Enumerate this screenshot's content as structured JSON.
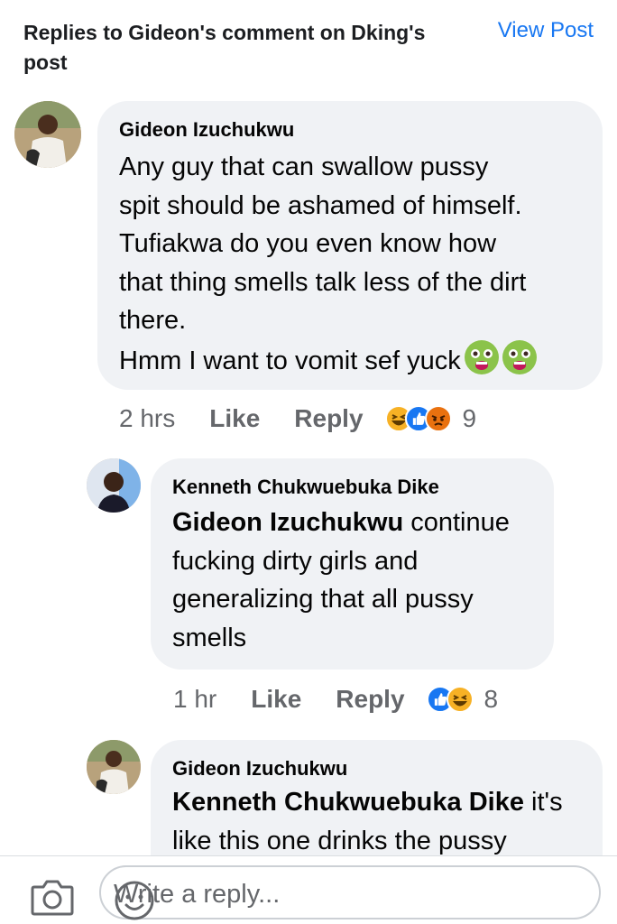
{
  "header": {
    "title": "Replies to Gideon's comment on Dking's post",
    "view_post": "View Post"
  },
  "comments": [
    {
      "author": "Gideon Izuchukwu",
      "lines": [
        "Any guy that can swallow pussy",
        "spit should be ashamed of himself.",
        "Tufiakwa do you even know how",
        "that thing smells talk less of the dirt",
        "there.",
        "Hmm I want to vomit sef yuck"
      ],
      "time": "2 hrs",
      "like": "Like",
      "reply": "Reply",
      "reactions": [
        "laugh",
        "like",
        "angry"
      ],
      "reaction_count": "9"
    },
    {
      "author": "Kenneth Chukwuebuka Dike",
      "mention": "Gideon Izuchukwu",
      "lines": [
        "continue",
        "fucking dirty girls and",
        "generalizing that all pussy",
        "smells"
      ],
      "time": "1 hr",
      "like": "Like",
      "reply": "Reply",
      "reactions": [
        "like",
        "laugh"
      ],
      "reaction_count": "8"
    },
    {
      "author": "Gideon Izuchukwu",
      "mention": "Kenneth Chukwuebuka Dike",
      "lines": [
        "it's",
        "like this one drinks the pussy"
      ]
    }
  ],
  "composer": {
    "placeholder": "Write a reply...",
    "camera_icon": "camera-icon",
    "emoji_icon": "smiley-icon"
  }
}
